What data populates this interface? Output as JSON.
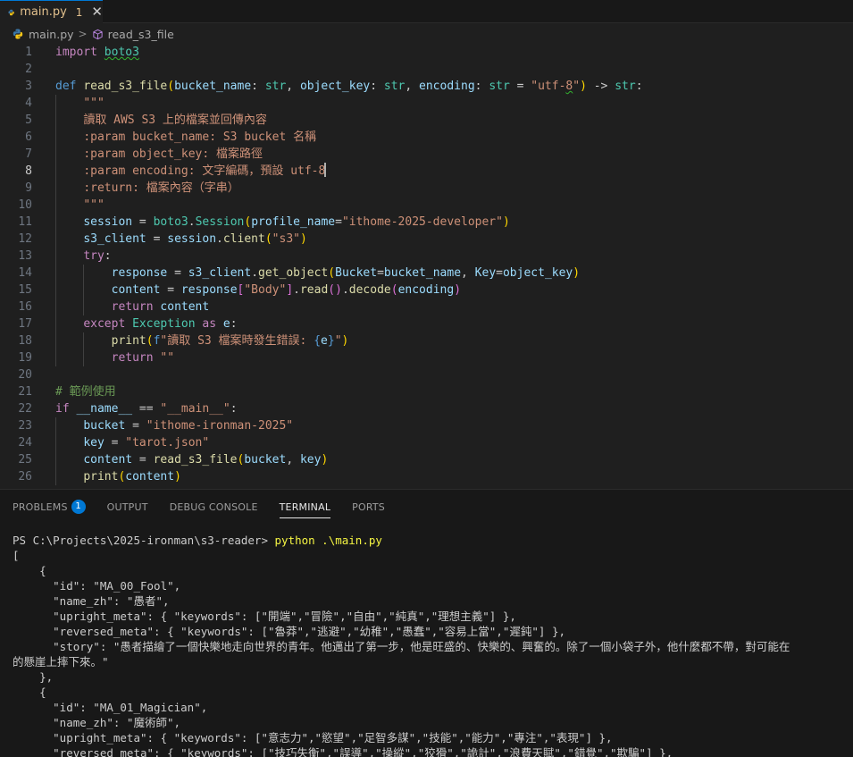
{
  "tab": {
    "filename": "main.py",
    "modified_count": "1",
    "close_glyph": "✕"
  },
  "breadcrumb": {
    "file": "main.py",
    "separator": ">",
    "symbol": "read_s3_file"
  },
  "editor": {
    "active_line": 8,
    "line_numbers": [
      "1",
      "2",
      "3",
      "4",
      "5",
      "6",
      "7",
      "8",
      "9",
      "10",
      "11",
      "12",
      "13",
      "14",
      "15",
      "16",
      "17",
      "18",
      "19",
      "20",
      "21",
      "22",
      "23",
      "24",
      "25",
      "26"
    ],
    "lines": [
      [
        [
          "kc",
          "import"
        ],
        [
          "t",
          " "
        ],
        [
          "cls uline",
          "boto3"
        ]
      ],
      [],
      [
        [
          "kw",
          "def"
        ],
        [
          "t",
          " "
        ],
        [
          "fn",
          "read_s3_file"
        ],
        [
          "br",
          "("
        ],
        [
          "var",
          "bucket_name"
        ],
        [
          "t",
          ": "
        ],
        [
          "cls",
          "str"
        ],
        [
          "t",
          ", "
        ],
        [
          "var",
          "object_key"
        ],
        [
          "t",
          ": "
        ],
        [
          "cls",
          "str"
        ],
        [
          "t",
          ", "
        ],
        [
          "var",
          "encoding"
        ],
        [
          "t",
          ": "
        ],
        [
          "cls",
          "str"
        ],
        [
          "t",
          " = "
        ],
        [
          "str",
          "\"utf-"
        ],
        [
          "str uline",
          "8"
        ],
        [
          "str",
          "\""
        ],
        [
          "br",
          ")"
        ],
        [
          "t",
          " -> "
        ],
        [
          "cls",
          "str"
        ],
        [
          "t",
          ":"
        ]
      ],
      [
        [
          "t",
          "    "
        ],
        [
          "str",
          "\"\"\""
        ]
      ],
      [
        [
          "t",
          "    "
        ],
        [
          "str",
          "讀取 AWS S3 上的檔案並回傳內容"
        ]
      ],
      [
        [
          "t",
          "    "
        ],
        [
          "str",
          ":param bucket_name: S3 bucket 名稱"
        ]
      ],
      [
        [
          "t",
          "    "
        ],
        [
          "str",
          ":param object_key: 檔案路徑"
        ]
      ],
      [
        [
          "t",
          "    "
        ],
        [
          "str",
          ":param encoding: 文字編碼，預設 utf-8"
        ],
        [
          "cursor",
          ""
        ]
      ],
      [
        [
          "t",
          "    "
        ],
        [
          "str",
          ":return: 檔案內容（字串）"
        ]
      ],
      [
        [
          "t",
          "    "
        ],
        [
          "str",
          "\"\"\""
        ]
      ],
      [
        [
          "t",
          "    "
        ],
        [
          "var",
          "session"
        ],
        [
          "t",
          " = "
        ],
        [
          "cls",
          "boto3"
        ],
        [
          "t",
          "."
        ],
        [
          "cls",
          "Session"
        ],
        [
          "br",
          "("
        ],
        [
          "var",
          "profile_name"
        ],
        [
          "t",
          "="
        ],
        [
          "str",
          "\"ithome-2025-developer\""
        ],
        [
          "br",
          ")"
        ]
      ],
      [
        [
          "t",
          "    "
        ],
        [
          "var",
          "s3_client"
        ],
        [
          "t",
          " = "
        ],
        [
          "var",
          "session"
        ],
        [
          "t",
          "."
        ],
        [
          "fn",
          "client"
        ],
        [
          "br",
          "("
        ],
        [
          "str",
          "\"s3\""
        ],
        [
          "br",
          ")"
        ]
      ],
      [
        [
          "t",
          "    "
        ],
        [
          "kc",
          "try"
        ],
        [
          "t",
          ":"
        ]
      ],
      [
        [
          "t",
          "        "
        ],
        [
          "var",
          "response"
        ],
        [
          "t",
          " = "
        ],
        [
          "var",
          "s3_client"
        ],
        [
          "t",
          "."
        ],
        [
          "fn",
          "get_object"
        ],
        [
          "br",
          "("
        ],
        [
          "var",
          "Bucket"
        ],
        [
          "t",
          "="
        ],
        [
          "var",
          "bucket_name"
        ],
        [
          "t",
          ", "
        ],
        [
          "var",
          "Key"
        ],
        [
          "t",
          "="
        ],
        [
          "var",
          "object_key"
        ],
        [
          "br",
          ")"
        ]
      ],
      [
        [
          "t",
          "        "
        ],
        [
          "var",
          "content"
        ],
        [
          "t",
          " = "
        ],
        [
          "var",
          "response"
        ],
        [
          "br2",
          "["
        ],
        [
          "str",
          "\"Body\""
        ],
        [
          "br2",
          "]"
        ],
        [
          "t",
          "."
        ],
        [
          "fn",
          "read"
        ],
        [
          "br2",
          "()"
        ],
        [
          "t",
          "."
        ],
        [
          "fn",
          "decode"
        ],
        [
          "br2",
          "("
        ],
        [
          "var",
          "encoding"
        ],
        [
          "br2",
          ")"
        ]
      ],
      [
        [
          "t",
          "        "
        ],
        [
          "kc",
          "return"
        ],
        [
          "t",
          " "
        ],
        [
          "var",
          "content"
        ]
      ],
      [
        [
          "t",
          "    "
        ],
        [
          "kc",
          "except"
        ],
        [
          "t",
          " "
        ],
        [
          "cls",
          "Exception"
        ],
        [
          "t",
          " "
        ],
        [
          "kc",
          "as"
        ],
        [
          "t",
          " "
        ],
        [
          "var",
          "e"
        ],
        [
          "t",
          ":"
        ]
      ],
      [
        [
          "t",
          "        "
        ],
        [
          "fn",
          "print"
        ],
        [
          "br",
          "("
        ],
        [
          "kw",
          "f"
        ],
        [
          "str",
          "\"讀取 S3 檔案時發生錯誤: "
        ],
        [
          "kw",
          "{"
        ],
        [
          "var",
          "e"
        ],
        [
          "kw",
          "}"
        ],
        [
          "str",
          "\""
        ],
        [
          "br",
          ")"
        ]
      ],
      [
        [
          "t",
          "        "
        ],
        [
          "kc",
          "return"
        ],
        [
          "t",
          " "
        ],
        [
          "str",
          "\"\""
        ]
      ],
      [],
      [
        [
          "cm",
          "# 範例使用"
        ]
      ],
      [
        [
          "kc",
          "if"
        ],
        [
          "t",
          " "
        ],
        [
          "var",
          "__name__"
        ],
        [
          "t",
          " == "
        ],
        [
          "str",
          "\"__main__\""
        ],
        [
          "t",
          ":"
        ]
      ],
      [
        [
          "t",
          "    "
        ],
        [
          "var",
          "bucket"
        ],
        [
          "t",
          " = "
        ],
        [
          "str",
          "\"ithome-ironman-2025\""
        ]
      ],
      [
        [
          "t",
          "    "
        ],
        [
          "var",
          "key"
        ],
        [
          "t",
          " = "
        ],
        [
          "str",
          "\"tarot.json\""
        ]
      ],
      [
        [
          "t",
          "    "
        ],
        [
          "var",
          "content"
        ],
        [
          "t",
          " = "
        ],
        [
          "fn",
          "read_s3_file"
        ],
        [
          "br",
          "("
        ],
        [
          "var",
          "bucket"
        ],
        [
          "t",
          ", "
        ],
        [
          "var",
          "key"
        ],
        [
          "br",
          ")"
        ]
      ],
      [
        [
          "t",
          "    "
        ],
        [
          "fn",
          "print"
        ],
        [
          "br",
          "("
        ],
        [
          "var",
          "content"
        ],
        [
          "br",
          ")"
        ]
      ]
    ]
  },
  "panel": {
    "tabs": [
      {
        "label": "PROBLEMS",
        "badge": "1",
        "active": false
      },
      {
        "label": "OUTPUT",
        "active": false
      },
      {
        "label": "DEBUG CONSOLE",
        "active": false
      },
      {
        "label": "TERMINAL",
        "active": true
      },
      {
        "label": "PORTS",
        "active": false
      }
    ]
  },
  "terminal": {
    "prompt": "PS C:\\Projects\\2025-ironman\\s3-reader> ",
    "command": "python .\\main.py",
    "output_lines": [
      "[",
      "    {",
      "      \"id\": \"MA_00_Fool\",",
      "      \"name_zh\": \"愚者\",",
      "      \"upright_meta\": { \"keywords\": [\"開端\",\"冒險\",\"自由\",\"純真\",\"理想主義\"] },",
      "      \"reversed_meta\": { \"keywords\": [\"魯莽\",\"逃避\",\"幼稚\",\"愚蠢\",\"容易上當\",\"遲鈍\"] },",
      "      \"story\": \"愚者描繪了一個快樂地走向世界的青年。他邁出了第一步，他是旺盛的、快樂的、興奮的。除了一個小袋子外，他什麼都不帶，對可能在",
      "的懸崖上摔下來。\"",
      "    },",
      "    {",
      "      \"id\": \"MA_01_Magician\",",
      "      \"name_zh\": \"魔術師\",",
      "      \"upright_meta\": { \"keywords\": [\"意志力\",\"慾望\",\"足智多謀\",\"技能\",\"能力\",\"專注\",\"表現\"] },",
      "      \"reversed_meta\": { \"keywords\": [\"技巧失衡\",\"誤導\",\"操縱\",\"狡猾\",\"詭計\",\"浪費天賦\",\"錯覺\",\"欺騙\"] },"
    ]
  },
  "colors": {
    "editor_bg": "#1f1f1f",
    "panel_bg": "#181818",
    "accent": "#0078d4",
    "modified_tab": "#e2c08d",
    "string": "#ce9178",
    "keyword": "#569cd6",
    "control": "#c586c0",
    "function": "#dcdcaa",
    "variable": "#9cdcfe",
    "type": "#4ec9b0",
    "comment": "#6a9955"
  }
}
